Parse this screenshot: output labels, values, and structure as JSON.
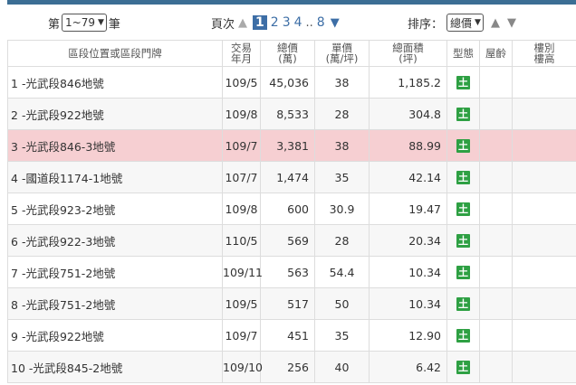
{
  "colors": {
    "accent": "#3d6ea6",
    "topbar": "#3c6e94",
    "highlight_row": "#f6cfd2",
    "type_badge": "#2ea043"
  },
  "controls": {
    "prefix": "第",
    "range_value": "1~79",
    "suffix": "筆",
    "pager_label": "頁次",
    "pages": [
      "1",
      "2",
      "3",
      "4"
    ],
    "current_page": "1",
    "ellipsis": "..",
    "last_page": "8",
    "sort_label": "排序：",
    "sort_value": "總價",
    "icons": {
      "prev": "triangle-up-icon",
      "next": "triangle-down-icon"
    }
  },
  "table": {
    "headers": {
      "address": "區段位置或區段門牌",
      "date_l1": "交易",
      "date_l2": "年月",
      "total_l1": "總價",
      "total_l2": "(萬)",
      "unit_l1": "單價",
      "unit_l2": "(萬/坪)",
      "area_l1": "總面積",
      "area_l2": "(坪)",
      "type": "型態",
      "age": "屋齡",
      "floor_l1": "樓別",
      "floor_l2": "樓高"
    },
    "type_badge": "土",
    "rows": [
      {
        "no": "1",
        "address": "-光武段846地號",
        "date": "109/5",
        "total": "45,036",
        "unit": "38",
        "area": "1,185.2"
      },
      {
        "no": "2",
        "address": "-光武段922地號",
        "date": "109/8",
        "total": "8,533",
        "unit": "28",
        "area": "304.8"
      },
      {
        "no": "3",
        "address": "-光武段846-3地號",
        "date": "109/7",
        "total": "3,381",
        "unit": "38",
        "area": "88.99"
      },
      {
        "no": "4",
        "address": "-國道段1174-1地號",
        "date": "107/7",
        "total": "1,474",
        "unit": "35",
        "area": "42.14"
      },
      {
        "no": "5",
        "address": "-光武段923-2地號",
        "date": "109/8",
        "total": "600",
        "unit": "30.9",
        "area": "19.47"
      },
      {
        "no": "6",
        "address": "-光武段922-3地號",
        "date": "110/5",
        "total": "569",
        "unit": "28",
        "area": "20.34"
      },
      {
        "no": "7",
        "address": "-光武段751-2地號",
        "date": "109/11",
        "total": "563",
        "unit": "54.4",
        "area": "10.34"
      },
      {
        "no": "8",
        "address": "-光武段751-2地號",
        "date": "109/5",
        "total": "517",
        "unit": "50",
        "area": "10.34"
      },
      {
        "no": "9",
        "address": "-光武段922地號",
        "date": "109/7",
        "total": "451",
        "unit": "35",
        "area": "12.90"
      },
      {
        "no": "10",
        "address": "-光武段845-2地號",
        "date": "109/10",
        "total": "256",
        "unit": "40",
        "area": "6.42"
      }
    ]
  }
}
